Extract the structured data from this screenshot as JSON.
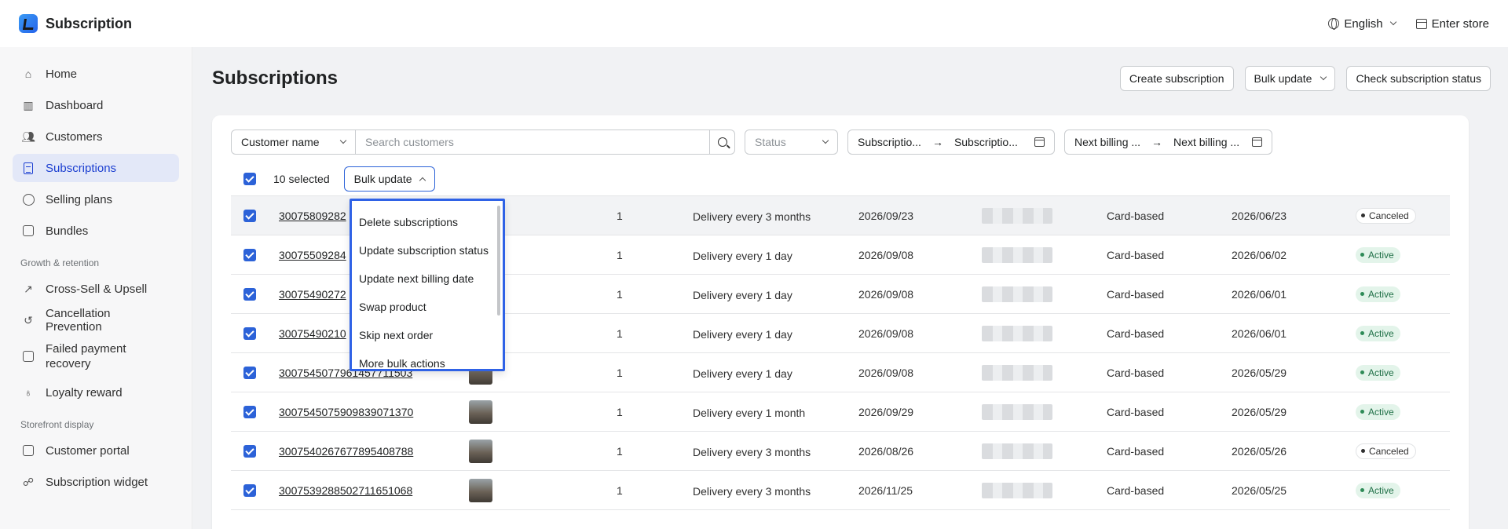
{
  "app": {
    "title": "Subscription",
    "language": "English",
    "enter_store": "Enter store"
  },
  "sidebar": {
    "items": [
      {
        "label": "Home",
        "icon": "home-icon"
      },
      {
        "label": "Dashboard",
        "icon": "chart-icon"
      },
      {
        "label": "Customers",
        "icon": "users-icon"
      },
      {
        "label": "Subscriptions",
        "icon": "document-icon",
        "active": true
      },
      {
        "label": "Selling plans",
        "icon": "tag-icon"
      },
      {
        "label": "Bundles",
        "icon": "box-icon"
      }
    ],
    "section_growth": "Growth & retention",
    "growth_items": [
      {
        "label": "Cross-Sell & Upsell",
        "icon": "trend-icon"
      },
      {
        "label": "Cancellation Prevention",
        "icon": "refresh-icon"
      },
      {
        "label": "Failed payment recovery",
        "icon": "wallet-icon"
      },
      {
        "label": "Loyalty reward",
        "icon": "medal-icon"
      }
    ],
    "section_storefront": "Storefront display",
    "storefront_items": [
      {
        "label": "Customer portal",
        "icon": "portal-icon"
      },
      {
        "label": "Subscription widget",
        "icon": "widget-icon"
      }
    ]
  },
  "page": {
    "title": "Subscriptions",
    "actions": {
      "create": "Create subscription",
      "bulk": "Bulk update",
      "check": "Check subscription status"
    }
  },
  "filters": {
    "customer_select": "Customer name",
    "search_placeholder": "Search customers",
    "status_placeholder": "Status",
    "sub_from": "Subscriptio...",
    "sub_to": "Subscriptio...",
    "next_from": "Next billing ...",
    "next_to": "Next billing ..."
  },
  "selection": {
    "count_label": "10 selected",
    "bulk_label": "Bulk update"
  },
  "dropdown": {
    "options": [
      "Delete subscriptions",
      "Update subscription status",
      "Update next billing date",
      "Swap product",
      "Skip next order",
      "More bulk actions"
    ]
  },
  "rows": [
    {
      "id": "30075809282",
      "qty": "1",
      "delivery": "Delivery every 3 months",
      "created": "2026/09/23",
      "payment": "Card-based",
      "next": "2026/06/23",
      "status": "Canceled"
    },
    {
      "id": "30075509284",
      "qty": "1",
      "delivery": "Delivery every 1 day",
      "created": "2026/09/08",
      "payment": "Card-based",
      "next": "2026/06/02",
      "status": "Active"
    },
    {
      "id": "30075490272",
      "qty": "1",
      "delivery": "Delivery every 1 day",
      "created": "2026/09/08",
      "payment": "Card-based",
      "next": "2026/06/01",
      "status": "Active"
    },
    {
      "id": "30075490210",
      "qty": "1",
      "delivery": "Delivery every 1 day",
      "created": "2026/09/08",
      "payment": "Card-based",
      "next": "2026/06/01",
      "status": "Active"
    },
    {
      "id": "3007545077961457711503",
      "qty": "1",
      "delivery": "Delivery every 1 day",
      "created": "2026/09/08",
      "payment": "Card-based",
      "next": "2026/05/29",
      "status": "Active"
    },
    {
      "id": "3007545075909839071370",
      "qty": "1",
      "delivery": "Delivery every 1 month",
      "created": "2026/09/29",
      "payment": "Card-based",
      "next": "2026/05/29",
      "status": "Active"
    },
    {
      "id": "3007540267677895408788",
      "qty": "1",
      "delivery": "Delivery every 3 months",
      "created": "2026/08/26",
      "payment": "Card-based",
      "next": "2026/05/26",
      "status": "Canceled"
    },
    {
      "id": "3007539288502711651068",
      "qty": "1",
      "delivery": "Delivery every 3 months",
      "created": "2026/11/25",
      "payment": "Card-based",
      "next": "2026/05/25",
      "status": "Active"
    }
  ],
  "colors": {
    "accent": "#2c62d8",
    "active_badge": "#e3f4ea",
    "sidebar_active": "#e3e8f8"
  }
}
